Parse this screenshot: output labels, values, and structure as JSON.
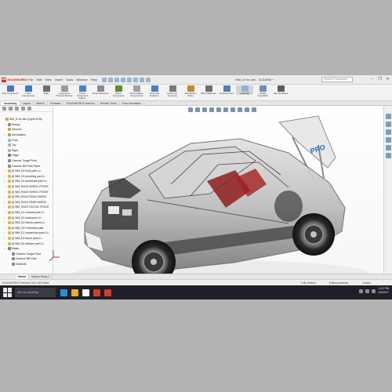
{
  "app": {
    "logo_text": "SOLIDWORKS",
    "menus": [
      "File",
      "Edit",
      "View",
      "Insert",
      "Tools",
      "Window",
      "Help"
    ],
    "doc_title": "WM_t2 for atm - SLDASM *",
    "search_placeholder": "Search Commands"
  },
  "commands": [
    {
      "label": "Edit Component",
      "icon": "edit-component-icon",
      "color": "#4a78b5"
    },
    {
      "label": "Insert Components",
      "icon": "insert-components-icon",
      "color": "#3c79c9"
    },
    {
      "label": "Mate",
      "icon": "mate-icon",
      "color": "#6d6d6d"
    },
    {
      "label": "Component Preview Window",
      "icon": "preview-window-icon",
      "color": "#9a9a9a"
    },
    {
      "label": "Linear Component Pattern",
      "icon": "pattern-icon",
      "color": "#4d82c0"
    },
    {
      "label": "Smart Fasteners",
      "icon": "fastener-icon",
      "color": "#8a8a8a"
    },
    {
      "label": "Move Component",
      "icon": "move-icon",
      "color": "#5d8d3a"
    },
    {
      "label": "Show Hidden Components",
      "icon": "show-hidden-icon",
      "color": "#a0a0a0"
    },
    {
      "label": "Assembly Features",
      "icon": "assembly-features-icon",
      "color": "#4c7fb8"
    },
    {
      "label": "Reference Geometry",
      "icon": "reference-geometry-icon",
      "color": "#7a7a7a"
    },
    {
      "label": "New Motion Study",
      "icon": "motion-study-icon",
      "color": "#c08a2f"
    },
    {
      "label": "Bill of Materials",
      "icon": "bom-icon",
      "color": "#6e6e6e"
    },
    {
      "label": "Exploded View",
      "icon": "exploded-view-icon",
      "color": "#4d7fb5"
    },
    {
      "label": "Instant3D",
      "icon": "instant3d-icon",
      "color": "#8db4dd"
    },
    {
      "label": "Update SpeedPak",
      "icon": "speedpak-icon",
      "color": "#6b8fb5"
    },
    {
      "label": "Take Snapshot",
      "icon": "snapshot-icon",
      "color": "#5d5d5d"
    }
  ],
  "tabs": [
    "Assembly",
    "Layout",
    "Sketch",
    "Evaluate",
    "SOLIDWORKS Add-Ins",
    "Render Tools",
    "Flow Simulation"
  ],
  "tree": {
    "items": [
      {
        "label": "WM_t2 for atm (Light+ATM)",
        "icon_color": "#d8a33a",
        "arrow": ""
      },
      {
        "label": "History",
        "icon_color": "#8a8a8a",
        "arrow": ">"
      },
      {
        "label": "Sensors",
        "icon_color": "#c0b040",
        "arrow": ""
      },
      {
        "label": "Annotations",
        "icon_color": "#c5a03f",
        "arrow": ">"
      },
      {
        "label": "Front",
        "icon_color": "#9fb6d0",
        "arrow": ""
      },
      {
        "label": "Top",
        "icon_color": "#9fb6d0",
        "arrow": ""
      },
      {
        "label": "Right",
        "icon_color": "#9fb6d0",
        "arrow": ""
      },
      {
        "label": "Origin",
        "icon_color": "#7a7a7a",
        "arrow": ""
      },
      {
        "label": "Camera Tungst Point",
        "icon_color": "#8a8a8a",
        "arrow": ""
      },
      {
        "label": "Camera 360 Path Plane",
        "icon_color": "#8a8a8a",
        "arrow": ""
      },
      {
        "label": "(f) WM_D2 body part<1>",
        "icon_color": "#e1b650",
        "arrow": ">"
      },
      {
        "label": "(f) WM_D2 plumbing par<1>",
        "icon_color": "#e1b650",
        "arrow": ">"
      },
      {
        "label": "(f) WM_D2 electricals part<1>",
        "icon_color": "#e1b650",
        "arrow": ">"
      },
      {
        "label": "(f) WM_RACE WHEEL FRONT",
        "icon_color": "#e1b650",
        "arrow": ">"
      },
      {
        "label": "(f) WM_RACE WHEEL FRONT",
        "icon_color": "#e1b650",
        "arrow": ">"
      },
      {
        "label": "(f) WM_RACE REAR WHEEL",
        "icon_color": "#e1b650",
        "arrow": ">"
      },
      {
        "label": "(f) WM_RACE REAR WHEEL",
        "icon_color": "#e1b650",
        "arrow": ">"
      },
      {
        "label": "(f) WM_RACE ON EGL FRONT",
        "icon_color": "#e1b650",
        "arrow": ">"
      },
      {
        "label": "(f) WM_D2 controls part<1>",
        "icon_color": "#e1b650",
        "arrow": ">"
      },
      {
        "label": "(f) WM_D2 seats part<1>",
        "icon_color": "#e1b650",
        "arrow": ">"
      },
      {
        "label": "(f) WM_D2 interior panels p",
        "icon_color": "#e1b650",
        "arrow": ">"
      },
      {
        "label": "(f) WM_D2 Powertrain part",
        "icon_color": "#e1b650",
        "arrow": ">"
      },
      {
        "label": "(f) WM_D2 suspension part<1>",
        "icon_color": "#e1b650",
        "arrow": ">"
      },
      {
        "label": "(f) WM_D2 frame part<1>",
        "icon_color": "#e1b650",
        "arrow": ">"
      },
      {
        "label": "(f) WM_D2 diffuser part<1>",
        "icon_color": "#e1b650",
        "arrow": ">"
      },
      {
        "label": "Mates",
        "icon_color": "#7f7f7f",
        "arrow": "v"
      },
      {
        "label": "Camera Tungst Point",
        "icon_color": "#8a8a8a",
        "arrow": ""
      },
      {
        "label": "Camera 360 Path",
        "icon_color": "#8a8a8a",
        "arrow": ""
      },
      {
        "label": "DI3AK45",
        "icon_color": "#8a8a8a",
        "arrow": ""
      }
    ]
  },
  "bottom_tabs": [
    "Model",
    "Motion Study 1"
  ],
  "status": {
    "left": "SOLIDWORKS Premium 2016 x64 Edition",
    "mid": "Fully Defined",
    "right": "Editing Assembly",
    "units": "Custom"
  },
  "taskbar": {
    "search_placeholder": "Ask me anything",
    "time": "2:22 PM",
    "date": "1/9/2017",
    "apps": [
      "#2a8dd8",
      "#e6b12b",
      "#ffffff",
      "#d83b2a",
      "#d83b2a"
    ]
  },
  "car": {
    "wing_text": "PRO"
  }
}
